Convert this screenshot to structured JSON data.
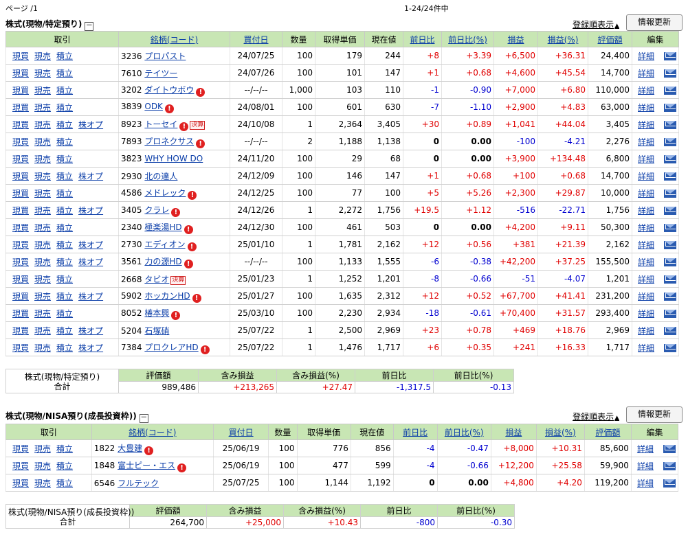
{
  "page_label": "ページ /1",
  "range_label": "1-24/24件中",
  "specific": {
    "title": "株式(現物/特定預り)",
    "collapse": "－",
    "register_order": "登録順表示",
    "register_arrow": "▲",
    "update_button": "情報更新",
    "headers": [
      "取引",
      "銘柄(コード)",
      "買付日",
      "数量",
      "取得単価",
      "現在値",
      "前日比",
      "前日比(%)",
      "損益",
      "損益(%)",
      "評価額",
      "編集"
    ],
    "rows": [
      {
        "code": "3236",
        "name": "プロパスト",
        "warn": false,
        "badge": "",
        "kabuop": false,
        "date": "24/07/25",
        "qty": "100",
        "cost": "179",
        "price": "244",
        "chg": "+8",
        "chgp": "+3.39",
        "pl": "+6,500",
        "plp": "+36.31",
        "val": "24,400"
      },
      {
        "code": "7610",
        "name": "テイツー",
        "warn": false,
        "badge": "",
        "kabuop": false,
        "date": "24/07/26",
        "qty": "100",
        "cost": "101",
        "price": "147",
        "chg": "+1",
        "chgp": "+0.68",
        "pl": "+4,600",
        "plp": "+45.54",
        "val": "14,700"
      },
      {
        "code": "3202",
        "name": "ダイトウボウ",
        "warn": true,
        "badge": "",
        "kabuop": false,
        "date": "--/--/--",
        "qty": "1,000",
        "cost": "103",
        "price": "110",
        "chg": "-1",
        "chgp": "-0.90",
        "pl": "+7,000",
        "plp": "+6.80",
        "val": "110,000"
      },
      {
        "code": "3839",
        "name": "ODK",
        "warn": true,
        "badge": "",
        "kabuop": false,
        "date": "24/08/01",
        "qty": "100",
        "cost": "601",
        "price": "630",
        "chg": "-7",
        "chgp": "-1.10",
        "pl": "+2,900",
        "plp": "+4.83",
        "val": "63,000"
      },
      {
        "code": "8923",
        "name": "トーセイ",
        "warn": true,
        "badge": "決算",
        "kabuop": true,
        "date": "24/10/08",
        "qty": "1",
        "cost": "2,364",
        "price": "3,405",
        "chg": "+30",
        "chgp": "+0.89",
        "pl": "+1,041",
        "plp": "+44.04",
        "val": "3,405"
      },
      {
        "code": "7893",
        "name": "プロネクサス",
        "warn": true,
        "badge": "",
        "kabuop": false,
        "date": "--/--/--",
        "qty": "2",
        "cost": "1,188",
        "price": "1,138",
        "chg": "0",
        "chgp": "0.00",
        "pl": "-100",
        "plp": "-4.21",
        "val": "2,276"
      },
      {
        "code": "3823",
        "name": "WHY HOW DO",
        "warn": false,
        "badge": "",
        "kabuop": false,
        "date": "24/11/20",
        "qty": "100",
        "cost": "29",
        "price": "68",
        "chg": "0",
        "chgp": "0.00",
        "pl": "+3,900",
        "plp": "+134.48",
        "val": "6,800"
      },
      {
        "code": "2930",
        "name": "北の達人",
        "warn": false,
        "badge": "",
        "kabuop": true,
        "date": "24/12/09",
        "qty": "100",
        "cost": "146",
        "price": "147",
        "chg": "+1",
        "chgp": "+0.68",
        "pl": "+100",
        "plp": "+0.68",
        "val": "14,700"
      },
      {
        "code": "4586",
        "name": "メドレック",
        "warn": true,
        "badge": "",
        "kabuop": false,
        "date": "24/12/25",
        "qty": "100",
        "cost": "77",
        "price": "100",
        "chg": "+5",
        "chgp": "+5.26",
        "pl": "+2,300",
        "plp": "+29.87",
        "val": "10,000"
      },
      {
        "code": "3405",
        "name": "クラレ",
        "warn": true,
        "badge": "",
        "kabuop": true,
        "date": "24/12/26",
        "qty": "1",
        "cost": "2,272",
        "price": "1,756",
        "chg": "+19.5",
        "chgp": "+1.12",
        "pl": "-516",
        "plp": "-22.71",
        "val": "1,756"
      },
      {
        "code": "2340",
        "name": "極楽湯HD",
        "warn": true,
        "badge": "",
        "kabuop": false,
        "date": "24/12/30",
        "qty": "100",
        "cost": "461",
        "price": "503",
        "chg": "0",
        "chgp": "0.00",
        "pl": "+4,200",
        "plp": "+9.11",
        "val": "50,300"
      },
      {
        "code": "2730",
        "name": "エディオン",
        "warn": true,
        "badge": "",
        "kabuop": true,
        "date": "25/01/10",
        "qty": "1",
        "cost": "1,781",
        "price": "2,162",
        "chg": "+12",
        "chgp": "+0.56",
        "pl": "+381",
        "plp": "+21.39",
        "val": "2,162"
      },
      {
        "code": "3561",
        "name": "力の源HD",
        "warn": true,
        "badge": "",
        "kabuop": true,
        "date": "--/--/--",
        "qty": "100",
        "cost": "1,133",
        "price": "1,555",
        "chg": "-6",
        "chgp": "-0.38",
        "pl": "+42,200",
        "plp": "+37.25",
        "val": "155,500"
      },
      {
        "code": "2668",
        "name": "タビオ",
        "warn": false,
        "badge": "決算",
        "kabuop": false,
        "date": "25/01/23",
        "qty": "1",
        "cost": "1,252",
        "price": "1,201",
        "chg": "-8",
        "chgp": "-0.66",
        "pl": "-51",
        "plp": "-4.07",
        "val": "1,201"
      },
      {
        "code": "5902",
        "name": "ホッカンHD",
        "warn": true,
        "badge": "",
        "kabuop": true,
        "date": "25/01/27",
        "qty": "100",
        "cost": "1,635",
        "price": "2,312",
        "chg": "+12",
        "chgp": "+0.52",
        "pl": "+67,700",
        "plp": "+41.41",
        "val": "231,200"
      },
      {
        "code": "8052",
        "name": "椿本興",
        "warn": true,
        "badge": "",
        "kabuop": false,
        "date": "25/03/10",
        "qty": "100",
        "cost": "2,230",
        "price": "2,934",
        "chg": "-18",
        "chgp": "-0.61",
        "pl": "+70,400",
        "plp": "+31.57",
        "val": "293,400"
      },
      {
        "code": "5204",
        "name": "石塚硝",
        "warn": false,
        "badge": "",
        "kabuop": true,
        "date": "25/07/22",
        "qty": "1",
        "cost": "2,500",
        "price": "2,969",
        "chg": "+23",
        "chgp": "+0.78",
        "pl": "+469",
        "plp": "+18.76",
        "val": "2,969"
      },
      {
        "code": "7384",
        "name": "プロクレアHD",
        "warn": true,
        "badge": "",
        "kabuop": true,
        "date": "25/07/22",
        "qty": "1",
        "cost": "1,476",
        "price": "1,717",
        "chg": "+6",
        "chgp": "+0.35",
        "pl": "+241",
        "plp": "+16.33",
        "val": "1,717"
      }
    ],
    "summary": {
      "label1": "株式(現物/特定預り)",
      "label2": "合計",
      "headers": [
        "評価額",
        "含み損益",
        "含み損益(%)",
        "前日比",
        "前日比(%)"
      ],
      "values": [
        "989,486",
        "+213,265",
        "+27.47",
        "-1,317.5",
        "-0.13"
      ]
    }
  },
  "nisa": {
    "title": "株式(現物/NISA預り(成長投資枠))",
    "collapse": "－",
    "register_order": "登録順表示",
    "register_arrow": "▲",
    "update_button": "情報更新",
    "headers": [
      "取引",
      "銘柄(コード)",
      "買付日",
      "数量",
      "取得単価",
      "現在値",
      "前日比",
      "前日比(%)",
      "損益",
      "損益(%)",
      "評価額",
      "編集"
    ],
    "rows": [
      {
        "code": "1822",
        "name": "大豊建",
        "warn": true,
        "badge": "",
        "kabuop": false,
        "date": "25/06/19",
        "qty": "100",
        "cost": "776",
        "price": "856",
        "chg": "-4",
        "chgp": "-0.47",
        "pl": "+8,000",
        "plp": "+10.31",
        "val": "85,600"
      },
      {
        "code": "1848",
        "name": "富士ピー・エス",
        "warn": true,
        "badge": "",
        "kabuop": false,
        "date": "25/06/19",
        "qty": "100",
        "cost": "477",
        "price": "599",
        "chg": "-4",
        "chgp": "-0.66",
        "pl": "+12,200",
        "plp": "+25.58",
        "val": "59,900"
      },
      {
        "code": "6546",
        "name": "フルテック",
        "warn": false,
        "badge": "",
        "kabuop": false,
        "date": "25/07/25",
        "qty": "100",
        "cost": "1,144",
        "price": "1,192",
        "chg": "0",
        "chgp": "0.00",
        "pl": "+4,800",
        "plp": "+4.20",
        "val": "119,200"
      }
    ],
    "summary": {
      "label1": "株式(現物/NISA預り(成長投資枠))",
      "label2": "合計",
      "headers": [
        "評価額",
        "含み損益",
        "含み損益(%)",
        "前日比",
        "前日比(%)"
      ],
      "values": [
        "264,700",
        "+25,000",
        "+10.43",
        "-800",
        "-0.30"
      ]
    }
  },
  "row_actions": {
    "buy": "現買",
    "sell": "現売",
    "accum": "積立",
    "option": "株オプ",
    "detail": "詳細"
  },
  "warn_glyph": "!",
  "icons": {
    "warning": "warning-icon",
    "mail": "mail-icon"
  },
  "colors": {
    "header_bg": "#c8e6b4",
    "positive": "#e00000",
    "negative": "#0000d0",
    "link": "#0a3da8"
  }
}
